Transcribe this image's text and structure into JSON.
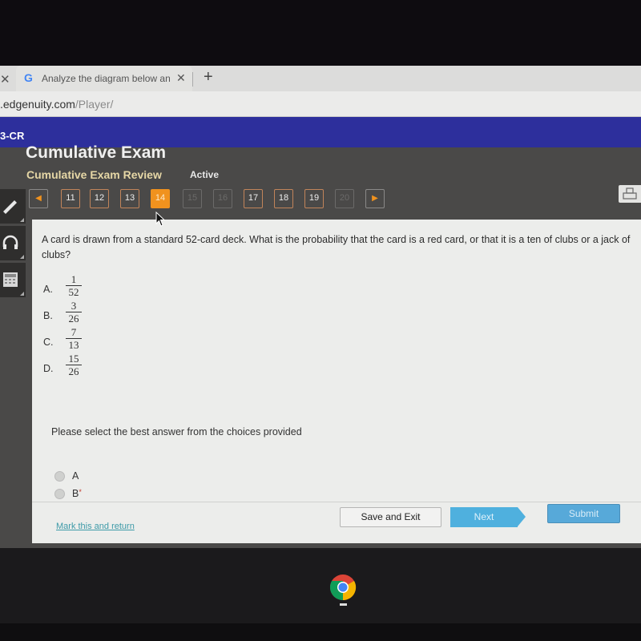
{
  "browser": {
    "tab_title": "Analyze the diagram below and",
    "favicon": "G",
    "url_domain": ".edgenuity.com",
    "url_path": "/Player/"
  },
  "banner": {
    "course_code": "3-CR"
  },
  "exam": {
    "title": "Cumulative Exam",
    "subtitle": "Cumulative Exam Review",
    "status": "Active"
  },
  "question_nav": {
    "prev_icon": "◀",
    "next_icon": "▶",
    "items": [
      {
        "label": "11",
        "state": "answered"
      },
      {
        "label": "12",
        "state": "answered"
      },
      {
        "label": "13",
        "state": "answered"
      },
      {
        "label": "14",
        "state": "current"
      },
      {
        "label": "15",
        "state": "disabled"
      },
      {
        "label": "16",
        "state": "disabled"
      },
      {
        "label": "17",
        "state": "answered"
      },
      {
        "label": "18",
        "state": "answered"
      },
      {
        "label": "19",
        "state": "answered"
      },
      {
        "label": "20",
        "state": "disabled"
      }
    ]
  },
  "side_tools": [
    {
      "name": "pencil-tool"
    },
    {
      "name": "headphones-tool"
    },
    {
      "name": "calculator-tool"
    }
  ],
  "question": {
    "text": "A card is drawn from a standard 52-card deck. What is the probability that the card is a red card, or that it is a ten of clubs or a jack of clubs?",
    "choices": [
      {
        "letter": "A.",
        "numerator": "1",
        "denominator": "52"
      },
      {
        "letter": "B.",
        "numerator": "3",
        "denominator": "26"
      },
      {
        "letter": "C.",
        "numerator": "7",
        "denominator": "13"
      },
      {
        "letter": "D.",
        "numerator": "15",
        "denominator": "26"
      }
    ],
    "instruction": "Please select the best answer from the choices provided",
    "options": [
      {
        "label": "A",
        "marker": ""
      },
      {
        "label": "B",
        "marker": "*"
      }
    ]
  },
  "footer": {
    "mark_link": "Mark this and return",
    "save_label": "Save and Exit",
    "next_label": "Next",
    "submit_label": "Submit"
  },
  "colors": {
    "banner": "#2d2f9c",
    "current_question": "#f0921e",
    "answered_border": "#c1845a",
    "next_button": "#4fb0de",
    "submit_button": "#57a9d9",
    "link": "#3d9aa8"
  }
}
